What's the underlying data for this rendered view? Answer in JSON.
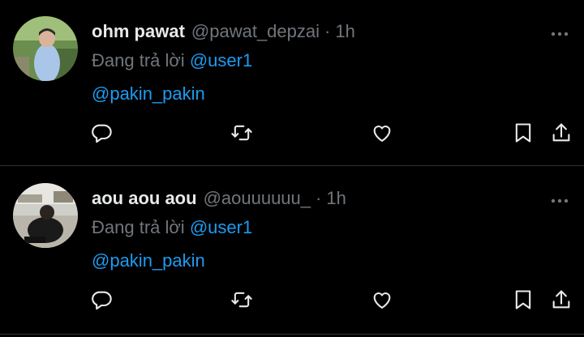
{
  "tweets": [
    {
      "name": "ohm pawat",
      "handle": "@pawat_depzai",
      "separator": "·",
      "time": "1h",
      "reply_prefix": "Đang trả lời",
      "reply_to": "@user1",
      "text": "@pakin_pakin"
    },
    {
      "name": "aou aou aou",
      "handle": "@aouuuuuu_",
      "separator": "·",
      "time": "1h",
      "reply_prefix": "Đang trả lời",
      "reply_to": "@user1",
      "text": "@pakin_pakin"
    }
  ],
  "icons": {
    "reply": "comment-icon",
    "retweet": "retweet-icon",
    "like": "heart-icon",
    "bookmark": "bookmark-icon",
    "share": "share-icon",
    "more": "more-icon"
  },
  "colors": {
    "background": "#000000",
    "text": "#e7e9ea",
    "secondary": "#71767b",
    "link": "#1d9bf0",
    "divider": "#2f3336"
  }
}
